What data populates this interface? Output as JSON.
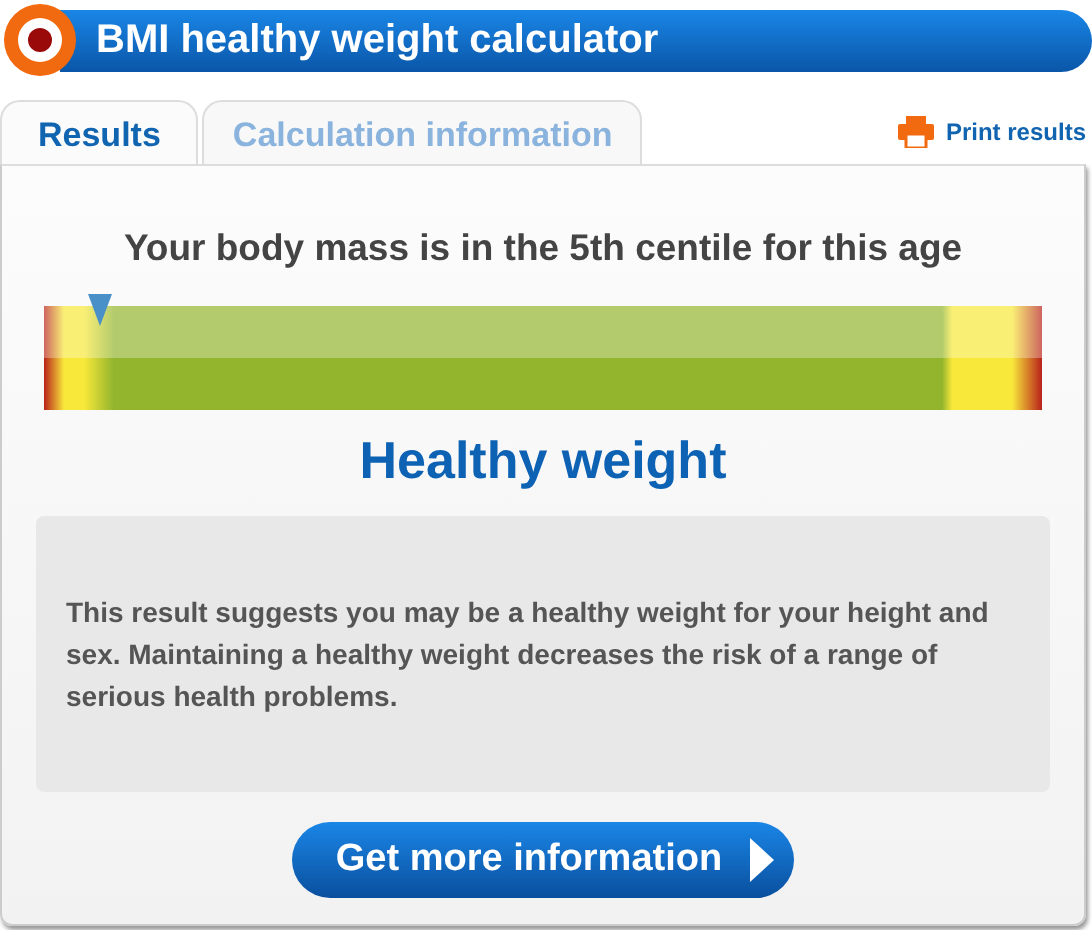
{
  "header": {
    "title": "BMI healthy weight calculator"
  },
  "tabs": [
    {
      "label": "Results",
      "selected": true
    },
    {
      "label": "Calculation information",
      "selected": false
    }
  ],
  "print_link": "Print results",
  "result": {
    "heading": "Your body mass is in the 5th centile for this age",
    "level": 0.056,
    "category": "Healthy weight",
    "description": "This result suggests you may be a healthy weight for your height and sex. Maintaining a healthy weight decreases the risk of a range of serious health problems."
  },
  "button": "Get more information"
}
